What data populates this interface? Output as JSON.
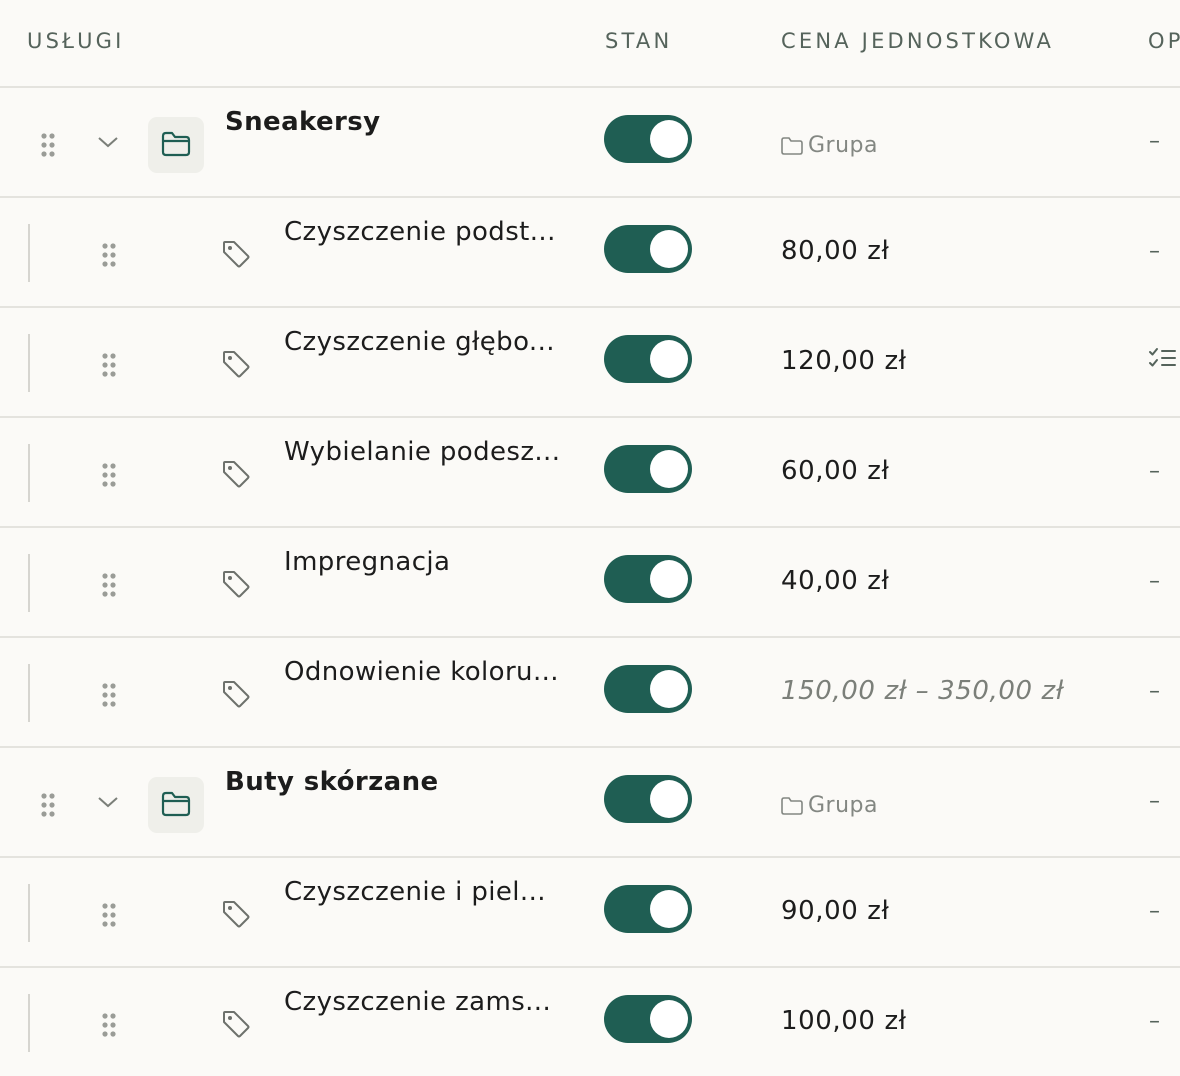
{
  "header": {
    "services": "USŁUGI",
    "state": "STAN",
    "unit_price": "CENA JEDNOSTKOWA",
    "options": "OP"
  },
  "theme": {
    "toggle_on": "#1f5e53",
    "accent": "#1f5e53",
    "muted_text": "#838782"
  },
  "rows": [
    {
      "type": "group",
      "name": "Sneakersy",
      "enabled": true,
      "price_label": "Grupa",
      "icon": "folder-icon",
      "options": "–"
    },
    {
      "type": "item",
      "name": "Czyszczenie podst...",
      "enabled": true,
      "price": "80,00 zł",
      "icon": "tag-icon",
      "options": "–"
    },
    {
      "type": "item",
      "name": "Czyszczenie głębo...",
      "enabled": true,
      "price": "120,00 zł",
      "icon": "tag-icon",
      "options_icon": "checklist-icon"
    },
    {
      "type": "item",
      "name": "Wybielanie podesz...",
      "enabled": true,
      "price": "60,00 zł",
      "icon": "tag-icon",
      "options": "–"
    },
    {
      "type": "item",
      "name": "Impregnacja",
      "enabled": true,
      "price": "40,00 zł",
      "icon": "tag-icon",
      "options": "–"
    },
    {
      "type": "item",
      "name": "Odnowienie koloru...",
      "enabled": true,
      "price": "150,00 zł – 350,00 zł",
      "icon": "tag-icon",
      "options": "–"
    },
    {
      "type": "group",
      "name": "Buty skórzane",
      "enabled": true,
      "price_label": "Grupa",
      "icon": "folder-icon",
      "options": "–"
    },
    {
      "type": "item",
      "name": "Czyszczenie i piel...",
      "enabled": true,
      "price": "90,00 zł",
      "icon": "tag-icon",
      "options": "–"
    },
    {
      "type": "item",
      "name": "Czyszczenie zams...",
      "enabled": true,
      "price": "100,00 zł",
      "icon": "tag-icon",
      "options": "–"
    }
  ]
}
